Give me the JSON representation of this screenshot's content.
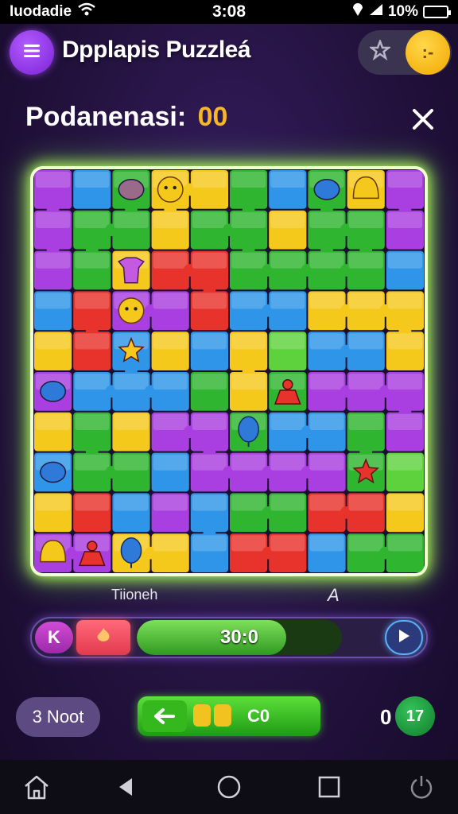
{
  "status_bar": {
    "carrier": "Iuodadie",
    "time": "3:08",
    "battery": "10%"
  },
  "header": {
    "title": "Dpplapis Puzzleá",
    "menu_icon": "menu-icon",
    "star_icon": "star-icon",
    "coin_label": ":-"
  },
  "score": {
    "label": "Podanenasi:",
    "value": "00"
  },
  "board": {
    "rows": 10,
    "cols": 10,
    "glow_color": "#b8ff5a",
    "palette": {
      "P": "#a93fe0",
      "B": "#2f95e8",
      "C": "#36c0ec",
      "G": "#2fb52f",
      "L": "#5ed23c",
      "Y": "#f5c81c",
      "R": "#e8332c",
      "O": "#f09a1c"
    },
    "cells": [
      "PBGYYGBGYP",
      "PGGYGGYGGP",
      "PGYRRGGGGB",
      "BRPPRBBYYY",
      "YRBYBYLBBY",
      "PBBBGYGPPP",
      "YGYPPGBBGP",
      "BGGBPPPPGL",
      "YRBPBGGRRY",
      "PPYYBRRBGG"
    ],
    "tokens": [
      {
        "kind": "blob",
        "color": "#9a6a8a",
        "row": 0,
        "col": 2
      },
      {
        "kind": "face",
        "color": "#f5c81c",
        "row": 0,
        "col": 3
      },
      {
        "kind": "blob",
        "color": "#2f7ad8",
        "row": 0,
        "col": 7
      },
      {
        "kind": "bell",
        "color": "#f5c81c",
        "row": 0,
        "col": 8
      },
      {
        "kind": "shirt",
        "color": "#c45ae0",
        "row": 2,
        "col": 2
      },
      {
        "kind": "face",
        "color": "#f5c81c",
        "row": 3,
        "col": 2
      },
      {
        "kind": "star",
        "color": "#f5c81c",
        "row": 4,
        "col": 2
      },
      {
        "kind": "person",
        "color": "#e8332c",
        "row": 5,
        "col": 6
      },
      {
        "kind": "balloon",
        "color": "#2f7ad8",
        "row": 6,
        "col": 5
      },
      {
        "kind": "blob",
        "color": "#2f7ad8",
        "row": 5,
        "col": 0
      },
      {
        "kind": "blob",
        "color": "#2f7ad8",
        "row": 7,
        "col": 0
      },
      {
        "kind": "star",
        "color": "#e8332c",
        "row": 7,
        "col": 8
      },
      {
        "kind": "bell",
        "color": "#f5c81c",
        "row": 9,
        "col": 0
      },
      {
        "kind": "person",
        "color": "#e8332c",
        "row": 9,
        "col": 1
      },
      {
        "kind": "balloon",
        "color": "#2f7ad8",
        "row": 9,
        "col": 2
      }
    ]
  },
  "labels": {
    "ticker": "Tiioneh",
    "marker": "A"
  },
  "controls": {
    "rewind_label": "K",
    "progress_text": "30:0",
    "progress_fraction": 0.73
  },
  "bottom": {
    "pill_label": "3 Noot",
    "action_label": "C0",
    "counter_value": "0",
    "counter_badge": "17"
  }
}
